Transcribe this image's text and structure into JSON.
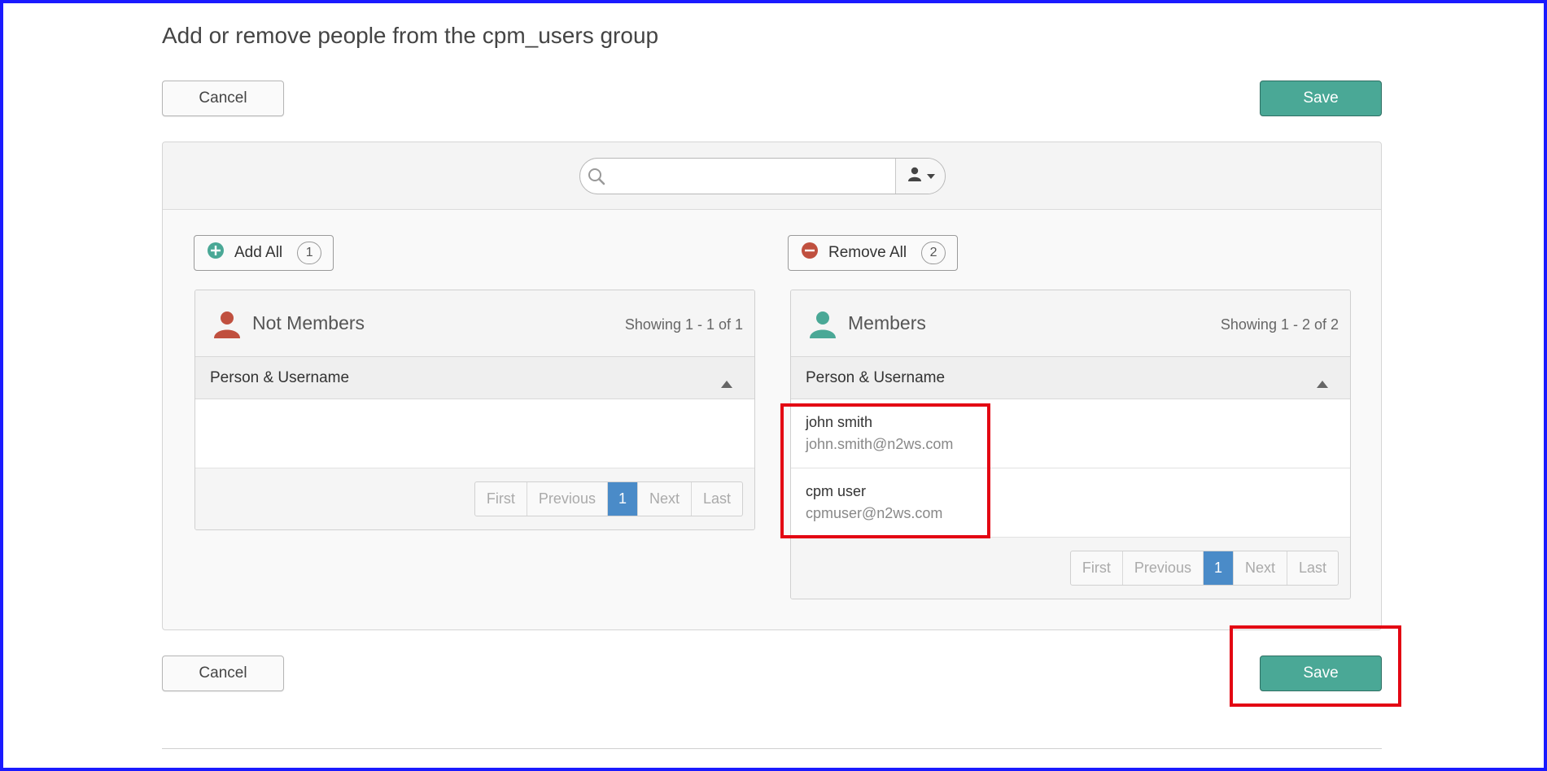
{
  "page": {
    "title": "Add or remove people from the cpm_users group"
  },
  "actions": {
    "cancel_label": "Cancel",
    "save_label": "Save"
  },
  "search": {
    "value": "",
    "placeholder": ""
  },
  "add_all": {
    "label": "Add All",
    "count": "1"
  },
  "remove_all": {
    "label": "Remove All",
    "count": "2"
  },
  "not_members": {
    "title": "Not Members",
    "showing": "Showing 1 - 1 of 1",
    "column": "Person & Username",
    "rows": [],
    "pager": {
      "first": "First",
      "previous": "Previous",
      "current": "1",
      "next": "Next",
      "last": "Last"
    }
  },
  "members": {
    "title": "Members",
    "showing": "Showing 1 - 2 of 2",
    "column": "Person & Username",
    "rows": [
      {
        "name": "john smith",
        "email": "john.smith@n2ws.com"
      },
      {
        "name": "cpm user",
        "email": "cpmuser@n2ws.com"
      }
    ],
    "pager": {
      "first": "First",
      "previous": "Previous",
      "current": "1",
      "next": "Next",
      "last": "Last"
    }
  },
  "colors": {
    "accent": "#4aa896",
    "not_member_icon": "#c0503f",
    "member_icon": "#4aa896",
    "remove_icon": "#c0503f",
    "pager_active": "#4a8bc8",
    "highlight": "#e30613",
    "frame": "#1a1aff"
  },
  "icons": {
    "search": "search-icon",
    "person": "person-icon",
    "add": "plus-circle-icon",
    "remove": "minus-circle-icon",
    "sort": "caret-up-icon"
  }
}
